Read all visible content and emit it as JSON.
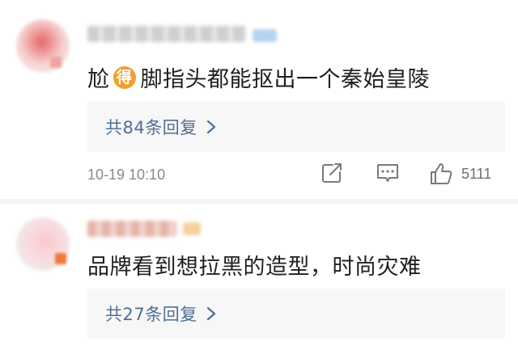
{
  "comments": [
    {
      "text_before": "尬",
      "emoji_char": "得",
      "text_after": "脚指头都能抠出一个秦始皇陵",
      "replies_label": "共84条回复",
      "timestamp": "10-19 10:10",
      "likes": "5111"
    },
    {
      "text": "品牌看到想拉黑的造型，时尚灾难",
      "replies_label": "共27条回复"
    }
  ],
  "colors": {
    "link": "#4f6f97",
    "text": "#1f1f1f",
    "meta": "#8a8a8a",
    "emoji_bg": "#f29f2e"
  },
  "icons": [
    "chevron-right-icon",
    "share-icon",
    "comment-icon",
    "like-icon"
  ]
}
